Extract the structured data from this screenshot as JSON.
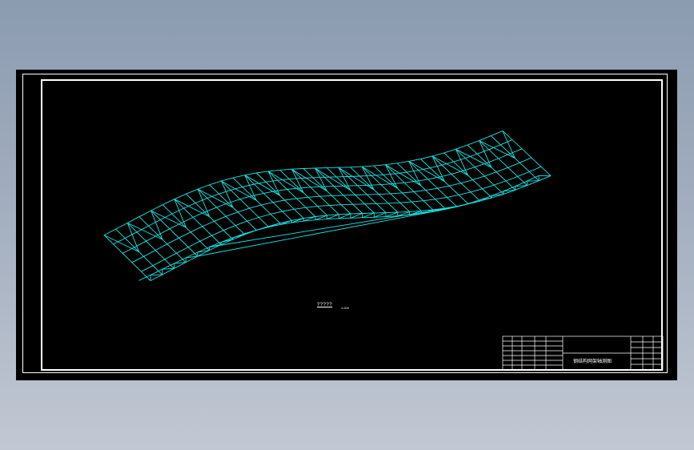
{
  "drawing": {
    "scale_label": "?????",
    "scale_ratio": "1:200",
    "title": "钢结构网架轴测图",
    "line_color": "#19e6e6",
    "frame_color": "#ffffff",
    "background_color": "#000000"
  }
}
